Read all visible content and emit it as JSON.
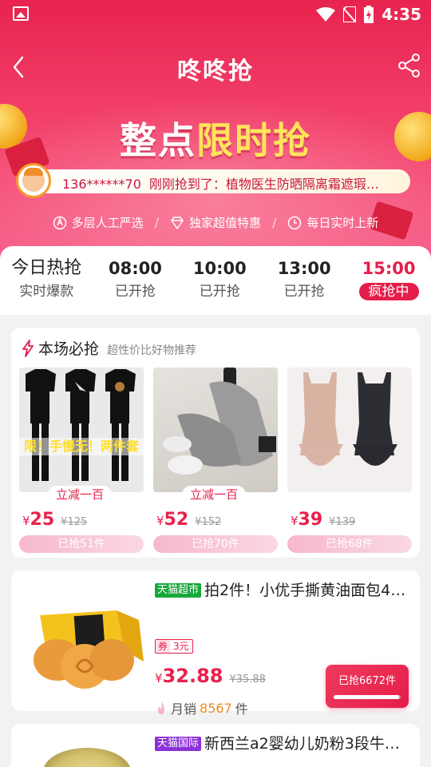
{
  "status_bar": {
    "time": "4:35"
  },
  "nav": {
    "title": "咚咚抢"
  },
  "banner": {
    "title_part1": "整点",
    "title_part2": "限时抢"
  },
  "ticker": {
    "user": "136******70",
    "message": "刚刚抢到了：植物医生防晒隔离霜遮瑕…"
  },
  "features": [
    {
      "icon": "handpick-icon",
      "label": "多层人工严选"
    },
    {
      "icon": "diamond-icon",
      "label": "独家超值特惠"
    },
    {
      "icon": "clock-icon",
      "label": "每日实时上新"
    }
  ],
  "time_tabs": [
    {
      "time": "今日热抢",
      "status": "实时爆款"
    },
    {
      "time": "08:00",
      "status": "已开抢"
    },
    {
      "time": "10:00",
      "status": "已开抢"
    },
    {
      "time": "13:00",
      "status": "已开抢"
    },
    {
      "time": "15:00",
      "status": "疯抢中",
      "active": true
    }
  ],
  "picks": {
    "title": "本场必抢",
    "subtitle": "超性价比好物推荐",
    "products": [
      {
        "overlay": "限！手慢无！两件套",
        "promo": "立减一百",
        "currency": "¥",
        "price": "25",
        "old_price": "¥125",
        "sold": "已抢51件"
      },
      {
        "overlay": "",
        "promo": "立减一百",
        "currency": "¥",
        "price": "52",
        "old_price": "¥152",
        "sold": "已抢70件"
      },
      {
        "overlay": "",
        "promo": "",
        "currency": "¥",
        "price": "39",
        "old_price": "¥139",
        "sold": "已抢68件"
      }
    ]
  },
  "items": [
    {
      "store": "天猫超市",
      "title": "拍2件！小优手撕黄油面包4…",
      "coupon_label": "券",
      "coupon_value": "3元",
      "currency": "¥",
      "price": "32.88",
      "old_price": "¥35.88",
      "monthly_label": "月销",
      "monthly_count": "8567",
      "monthly_unit": "件",
      "grab_label": "已抢6672件",
      "grab_progress": 0.98
    },
    {
      "store": "天猫国际",
      "title": "新西兰a2婴幼儿奶粉3段牛…"
    }
  ],
  "colors": {
    "accent": "#e51d4a",
    "banner_highlight": "#ffe45c",
    "tmall_green": "#18a83a",
    "tmall_purple": "#8c31d8"
  }
}
